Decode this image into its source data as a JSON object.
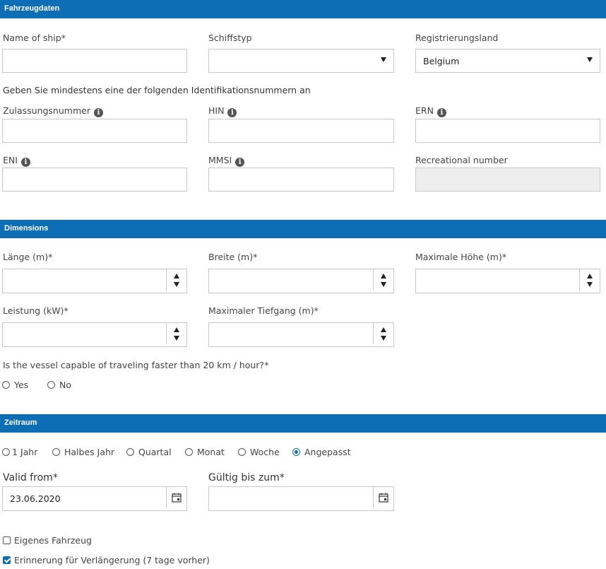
{
  "sections": {
    "vehicle": "Fahrzeugdaten",
    "dimensions": "Dimensions",
    "period": "Zeitraum"
  },
  "vehicle": {
    "name_label": "Name of ship",
    "type_label": "Schiffstyp",
    "type_value": "",
    "country_label": "Registrierungsland",
    "country_value": "Belgium",
    "id_hint": "Geben Sie mindestens eine der folgenden Identifikationsnummern an",
    "zulassung_label": "Zulassungsnummer",
    "hin_label": "HIN",
    "ern_label": "ERN",
    "eni_label": "ENI",
    "mmsi_label": "MMSI",
    "recreational_label": "Recreational number"
  },
  "dimensions": {
    "length_label": "Länge (m)",
    "width_label": "Breite (m)",
    "height_label": "Maximale Höhe (m)",
    "power_label": "Leistung (kW)",
    "draft_label": "Maximaler Tiefgang (m)",
    "speed_question": "Is the vessel capable of traveling faster than 20 km / hour?",
    "yes_label": "Yes",
    "no_label": "No"
  },
  "period": {
    "options": [
      "1 Jahr",
      "Halbes Jahr",
      "Quartal",
      "Monat",
      "Woche",
      "Angepasst"
    ],
    "selected": "Angepasst",
    "valid_from_label": "Valid from",
    "valid_from_value": "23.06.2020",
    "valid_to_label": "Gültig bis zum",
    "valid_to_value": "",
    "own_vehicle_label": "Eigenes Fahrzeug",
    "own_vehicle_checked": false,
    "reminder_label": "Erinnerung für Verlängerung (7 tage vorher)",
    "reminder_checked": true
  },
  "required_marker": "*",
  "colors": {
    "section_bar": "#0d6db5",
    "disabled_field": "#eeeeee",
    "field_border": "#c8c8c8"
  }
}
